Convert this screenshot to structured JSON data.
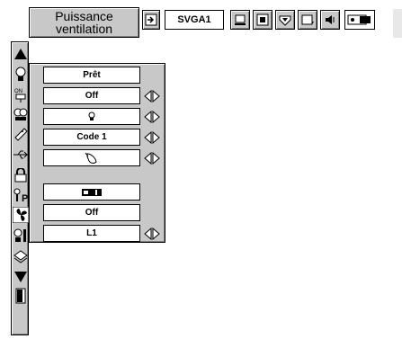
{
  "header": {
    "title_line1": "Puissance",
    "title_line2": "ventilation",
    "signal": "SVGA1",
    "toolbar_icons": [
      "input-icon",
      "computer-icon",
      "image-icon",
      "picture-adjust-icon",
      "screen-icon",
      "sound-icon",
      "projector-icon"
    ]
  },
  "side_icons": [
    "up-arrow-icon",
    "lamp-icon",
    "power-plug-icon",
    "lamp-control-icon",
    "remote-control-icon",
    "usb-connector-icon",
    "lock-icon",
    "key-pin-icon",
    "fan-icon",
    "lamp-reset-icon",
    "filter-icon",
    "down-arrow-icon",
    "exit-door-icon"
  ],
  "rows": [
    {
      "value": "Prêt",
      "type": "text",
      "arrows": false
    },
    {
      "value": "Off",
      "type": "text",
      "arrows": true
    },
    {
      "value": "lamp-small-icon",
      "type": "icon",
      "arrows": true
    },
    {
      "value": "Code 1",
      "type": "text",
      "arrows": true
    },
    {
      "value": "mouse-icon",
      "type": "icon",
      "arrows": true
    },
    {
      "value": "projector-small-icon",
      "type": "icon",
      "arrows": false
    },
    {
      "value": "Off",
      "type": "text",
      "arrows": false
    },
    {
      "value": "L1",
      "type": "text",
      "arrows": true
    }
  ],
  "colors": {
    "panel": "#c8c8c8",
    "box": "#ffffff",
    "outline": "#000000"
  }
}
